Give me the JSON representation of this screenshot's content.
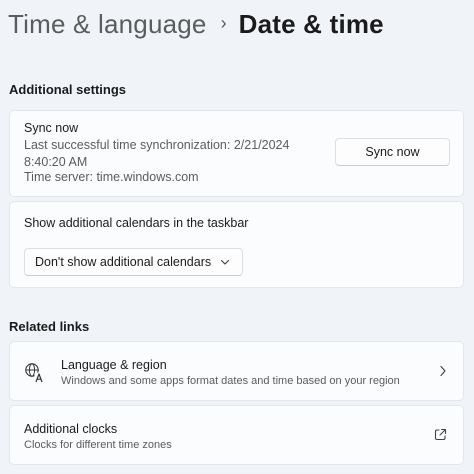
{
  "breadcrumb": {
    "parent": "Time & language",
    "separator": "›",
    "current": "Date & time"
  },
  "additional_settings": {
    "heading": "Additional settings",
    "sync": {
      "title": "Sync now",
      "description": "Last successful time synchronization: 2/21/2024 8:40:20 AM",
      "server": "Time server: time.windows.com",
      "button_label": "Sync now"
    },
    "calendars": {
      "title": "Show additional calendars in the taskbar",
      "selected_option": "Don't show additional calendars"
    }
  },
  "related_links": {
    "heading": "Related links",
    "language_region": {
      "title": "Language & region",
      "subtitle": "Windows and some apps format dates and time based on your region",
      "icon": "language-icon"
    },
    "additional_clocks": {
      "title": "Additional clocks",
      "subtitle": "Clocks for different time zones",
      "icon": "external-link-icon"
    }
  }
}
